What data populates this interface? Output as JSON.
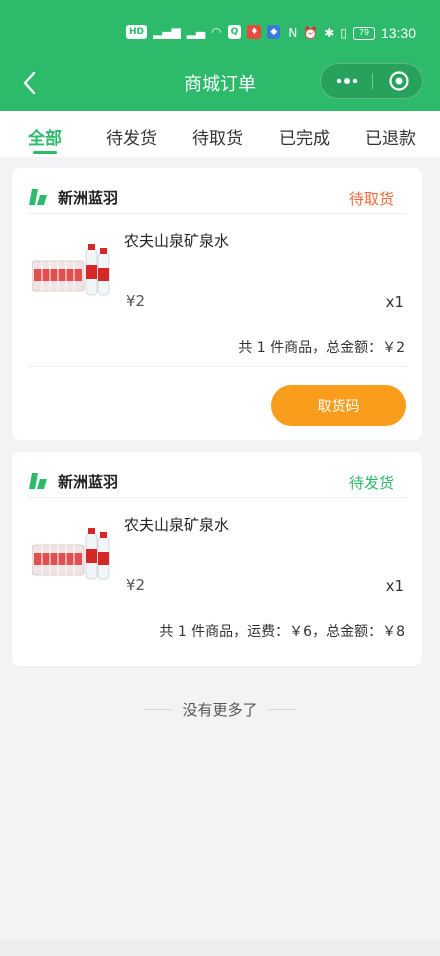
{
  "status_bar": {
    "left_icons": [
      "HD",
      "4G",
      "wifi-icon",
      "search-app-icon",
      "red-app-icon",
      "shield-app-icon"
    ],
    "right_icons": [
      "nfc-icon",
      "alarm-icon",
      "bluetooth-icon",
      "vibrate-icon"
    ],
    "battery": "79",
    "time": "13:30"
  },
  "navbar": {
    "title": "商城订单",
    "more_icon": "more-dots-icon",
    "target_icon": "target-icon"
  },
  "tabs": [
    "全部",
    "待发货",
    "待取货",
    "已完成",
    "已退款"
  ],
  "active_tab": 0,
  "orders": [
    {
      "store": "新洲蓝羽",
      "status": "待取货",
      "status_color": "#f06a3c",
      "product_name": "农夫山泉矿泉水",
      "price": "¥2",
      "quantity": "x1",
      "summary": "共 1 件商品，总金额：￥2",
      "button_label": "取货码"
    },
    {
      "store": "新洲蓝羽",
      "status": "待发货",
      "status_color": "#2dbb6b",
      "product_name": "农夫山泉矿泉水",
      "price": "¥2",
      "quantity": "x1",
      "summary": "共 1 件商品，运费：￥6，总金额：￥8"
    }
  ],
  "footer_text": "没有更多了",
  "colors": {
    "brand": "#2dbb6b",
    "pickup_button": "#fa9d1c"
  }
}
